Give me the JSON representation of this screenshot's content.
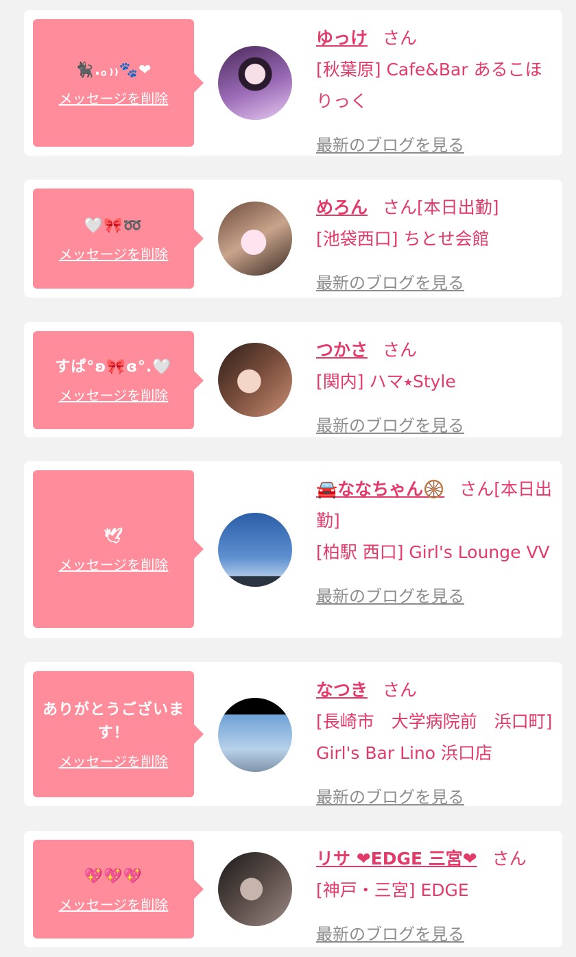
{
  "delete_label": "メッセージを削除",
  "blog_label": "最新のブログを見る",
  "honorific": "さん",
  "entries": [
    {
      "message": "🐈‍⬛.｡₎₎🐾❤︎",
      "name": "ゆっけ",
      "status": "",
      "shop": "[秋葉原] Cafe&Bar あるこほりっく"
    },
    {
      "message": "🤍🎀➿",
      "name": "めろん",
      "status": "[本日出勤]",
      "shop": "[池袋西口] ちとせ会館"
    },
    {
      "message": "すぱ°ʚ🎀ɞ°.🤍",
      "name": "つかさ",
      "status": "",
      "shop": "[関内] ハマ⭑Style"
    },
    {
      "message": "🕊",
      "name": "🚘ななちゃん🛞",
      "status": "[本日出勤]",
      "shop": "[柏駅 西口] Girl's Lounge VV"
    },
    {
      "message": "ありがとうございます！",
      "name": "なつき",
      "status": "",
      "shop": "[長崎市　大学病院前　浜口町] Girl's Bar Lino 浜口店"
    },
    {
      "message": "💖💖💖",
      "name": "リサ ❤EDGE 三宮❤",
      "status": "",
      "shop": "[神戸・三宮] EDGE"
    }
  ]
}
